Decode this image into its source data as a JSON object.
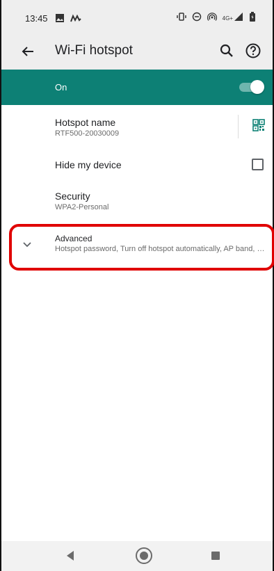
{
  "status_bar": {
    "time": "13:45",
    "left_icons": [
      "image-icon",
      "app-notification-icon"
    ],
    "right_icons": [
      "vibrate-icon",
      "do-not-disturb-icon",
      "hotspot-icon",
      "network-4g-icon",
      "signal-icon",
      "battery-icon"
    ],
    "network_label": "4G+"
  },
  "app_bar": {
    "title": "Wi-Fi hotspot",
    "icons": [
      "back-arrow-icon",
      "search-icon",
      "help-icon"
    ]
  },
  "master_switch": {
    "label": "On",
    "enabled": true,
    "accent_color": "#0d8075"
  },
  "settings": {
    "hotspot_name": {
      "title": "Hotspot name",
      "value": "RTF500-20030009"
    },
    "hide_device": {
      "title": "Hide my device",
      "checked": false
    },
    "security": {
      "title": "Security",
      "value": "WPA2-Personal"
    },
    "advanced": {
      "title": "Advanced",
      "summary": "Hotspot password, Turn off hotspot automatically, AP band, Cli..",
      "expanded": false,
      "highlight_color": "#e00000"
    }
  },
  "nav_bar": {
    "buttons": [
      "nav-back-icon",
      "nav-home-icon",
      "nav-recents-icon"
    ]
  }
}
